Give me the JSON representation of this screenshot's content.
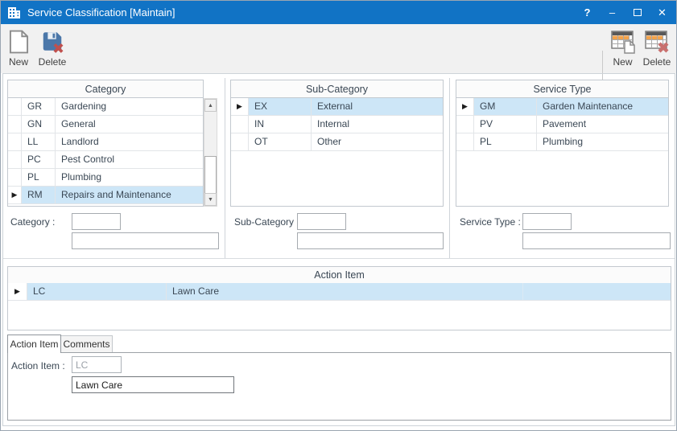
{
  "window": {
    "title": "Service Classification [Maintain]",
    "controls": {
      "help": "?",
      "minimize": "–",
      "close": "✕"
    }
  },
  "toolbar": {
    "left_new_label": "New",
    "left_delete_label": "Delete",
    "right_new_label": "New",
    "right_delete_label": "Delete"
  },
  "panels": {
    "category": {
      "title": "Category",
      "footer_label": "Category :",
      "footer_code_value": "",
      "footer_desc_value": "",
      "rows": [
        {
          "code": "GR",
          "desc": "Gardening",
          "selected": false
        },
        {
          "code": "GN",
          "desc": "General",
          "selected": false
        },
        {
          "code": "LL",
          "desc": "Landlord",
          "selected": false
        },
        {
          "code": "PC",
          "desc": "Pest Control",
          "selected": false
        },
        {
          "code": "PL",
          "desc": "Plumbing",
          "selected": false
        },
        {
          "code": "RM",
          "desc": "Repairs and Maintenance",
          "selected": true
        }
      ]
    },
    "subcategory": {
      "title": "Sub-Category",
      "footer_label": "Sub-Category :",
      "footer_code_value": "",
      "footer_desc_value": "",
      "rows": [
        {
          "code": "EX",
          "desc": "External",
          "selected": true
        },
        {
          "code": "IN",
          "desc": "Internal",
          "selected": false
        },
        {
          "code": "OT",
          "desc": "Other",
          "selected": false
        }
      ]
    },
    "servicetype": {
      "title": "Service Type",
      "footer_label": "Service Type :",
      "footer_code_value": "",
      "footer_desc_value": "",
      "rows": [
        {
          "code": "GM",
          "desc": "Garden Maintenance",
          "selected": true
        },
        {
          "code": "PV",
          "desc": "Pavement",
          "selected": false
        },
        {
          "code": "PL",
          "desc": "Plumbing",
          "selected": false
        }
      ]
    }
  },
  "action_grid": {
    "title": "Action Item",
    "rows": [
      {
        "code": "LC",
        "desc": "Lawn Care",
        "selected": true
      }
    ]
  },
  "tabs": {
    "action_item": "Action Item",
    "comments": "Comments"
  },
  "tab_page": {
    "label": "Action Item :",
    "code_value": "LC",
    "desc_value": "Lawn Care"
  },
  "icons": {
    "row_marker": "▶",
    "scroll_up": "▲",
    "scroll_down": "▼"
  },
  "colors": {
    "titlebar_blue": "#1173C5",
    "selection_blue": "#CDE6F7",
    "table_icon_orange": "#F2A24B",
    "delete_red": "#C0504D",
    "floppy_blue": "#4B77A9"
  }
}
